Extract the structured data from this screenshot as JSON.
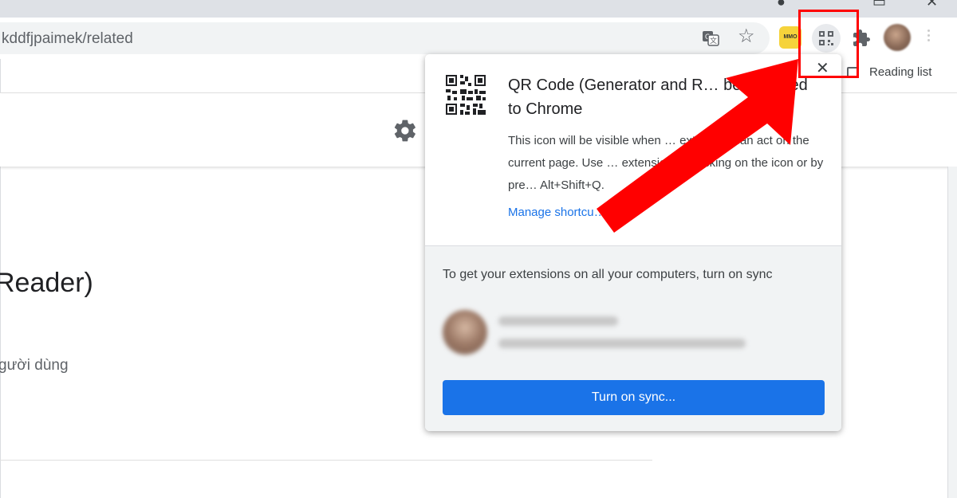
{
  "browser": {
    "url": "kddfjpaimek/related",
    "reading_list_label": "Reading list",
    "ext_badge_text": "MMO"
  },
  "page": {
    "heading": "Reader)",
    "subtext": "gười dùng"
  },
  "bubble": {
    "title": "QR Code (Generator and R… been added to Chrome",
    "body": "This icon will be visible when … extension can act on the current page. Use … extension by clicking on the icon or by pre… Alt+Shift+Q.",
    "manage_link": "Manage shortcu…",
    "sync_prompt": "To get your extensions on all your computers, turn on sync",
    "sync_button": "Turn on sync..."
  },
  "colors": {
    "accent_blue": "#1a73e8",
    "annotation_red": "#ff0000",
    "ext_yellow": "#f6d33b"
  },
  "icons": [
    "translate-icon",
    "star-icon",
    "extension-mmo-icon",
    "qr-extension-icon",
    "puzzle-icon",
    "profile-avatar",
    "reading-list-icon",
    "gear-icon",
    "qr-code-icon",
    "close-icon"
  ]
}
